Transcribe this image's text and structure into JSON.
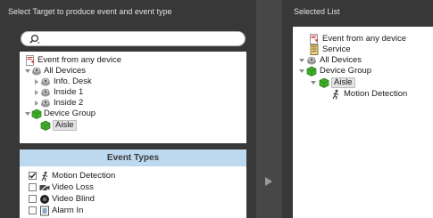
{
  "left_panel": {
    "header": "Select Target to produce event and event type",
    "search": {
      "placeholder": ""
    },
    "tree": {
      "event_any": "Event from any device",
      "all_devices": "All Devices",
      "info_desk": "Info. Desk",
      "inside1": "Inside 1",
      "inside2": "Inside 2",
      "device_group": "Device Group",
      "aisle": "Aisle"
    },
    "event_types": {
      "title": "Event Types",
      "items": [
        {
          "label": "Motion Detection",
          "checked": true
        },
        {
          "label": "Video Loss",
          "checked": false
        },
        {
          "label": "Video Blind",
          "checked": false
        },
        {
          "label": "Alarm In",
          "checked": false
        }
      ]
    }
  },
  "right_panel": {
    "header": "Selected List",
    "tree": {
      "event_any": "Event from any device",
      "service": "Service",
      "all_devices": "All Devices",
      "device_group": "Device Group",
      "aisle": "Aisle",
      "motion_detection": "Motion Detection"
    }
  },
  "colors": {
    "panel_bg": "#383838",
    "divider_bg": "#474747",
    "event_header_bg": "#bdd9ef",
    "group_green": "#3fae2a"
  }
}
